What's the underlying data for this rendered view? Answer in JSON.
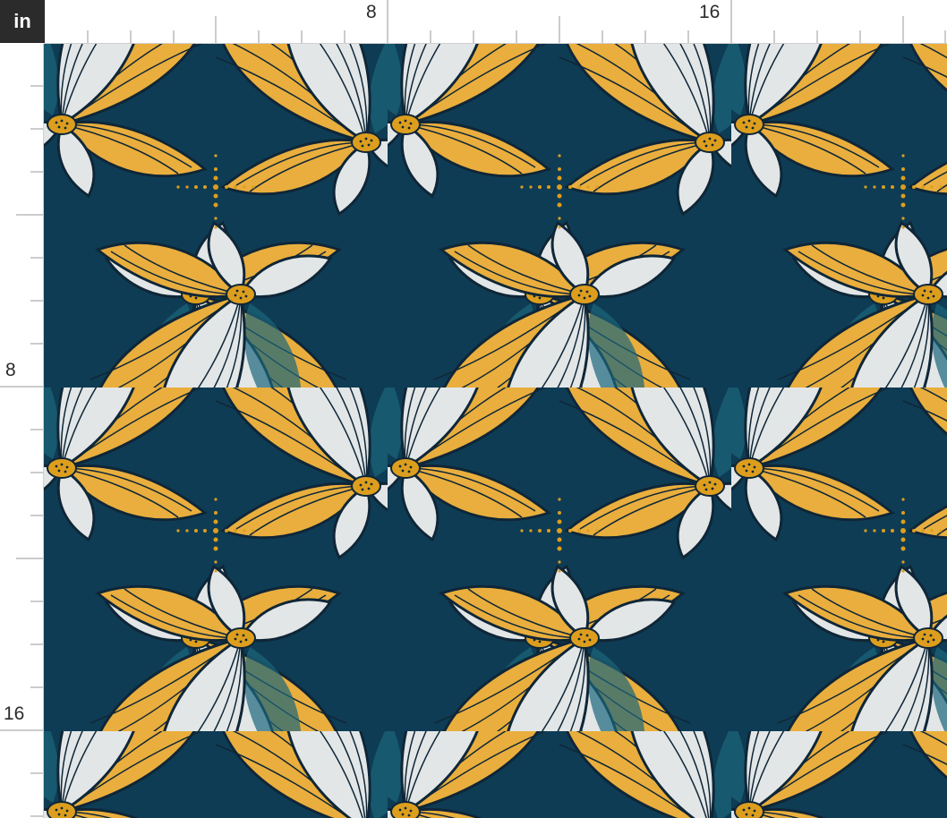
{
  "ruler": {
    "unit": "in",
    "top_labels": [
      "8",
      "16"
    ],
    "left_labels": [
      "8",
      "16"
    ]
  },
  "colors": {
    "background_teal": "#0f3f58",
    "petal_gold": "#f3b640",
    "petal_white": "#ecf0f1",
    "stroke_navy": "#10283a",
    "center_gold": "#e6a520",
    "leaf_teal": "#1d6a80"
  },
  "pattern": {
    "motif": "art-nouveau-flower",
    "icon": "flower-icon"
  }
}
